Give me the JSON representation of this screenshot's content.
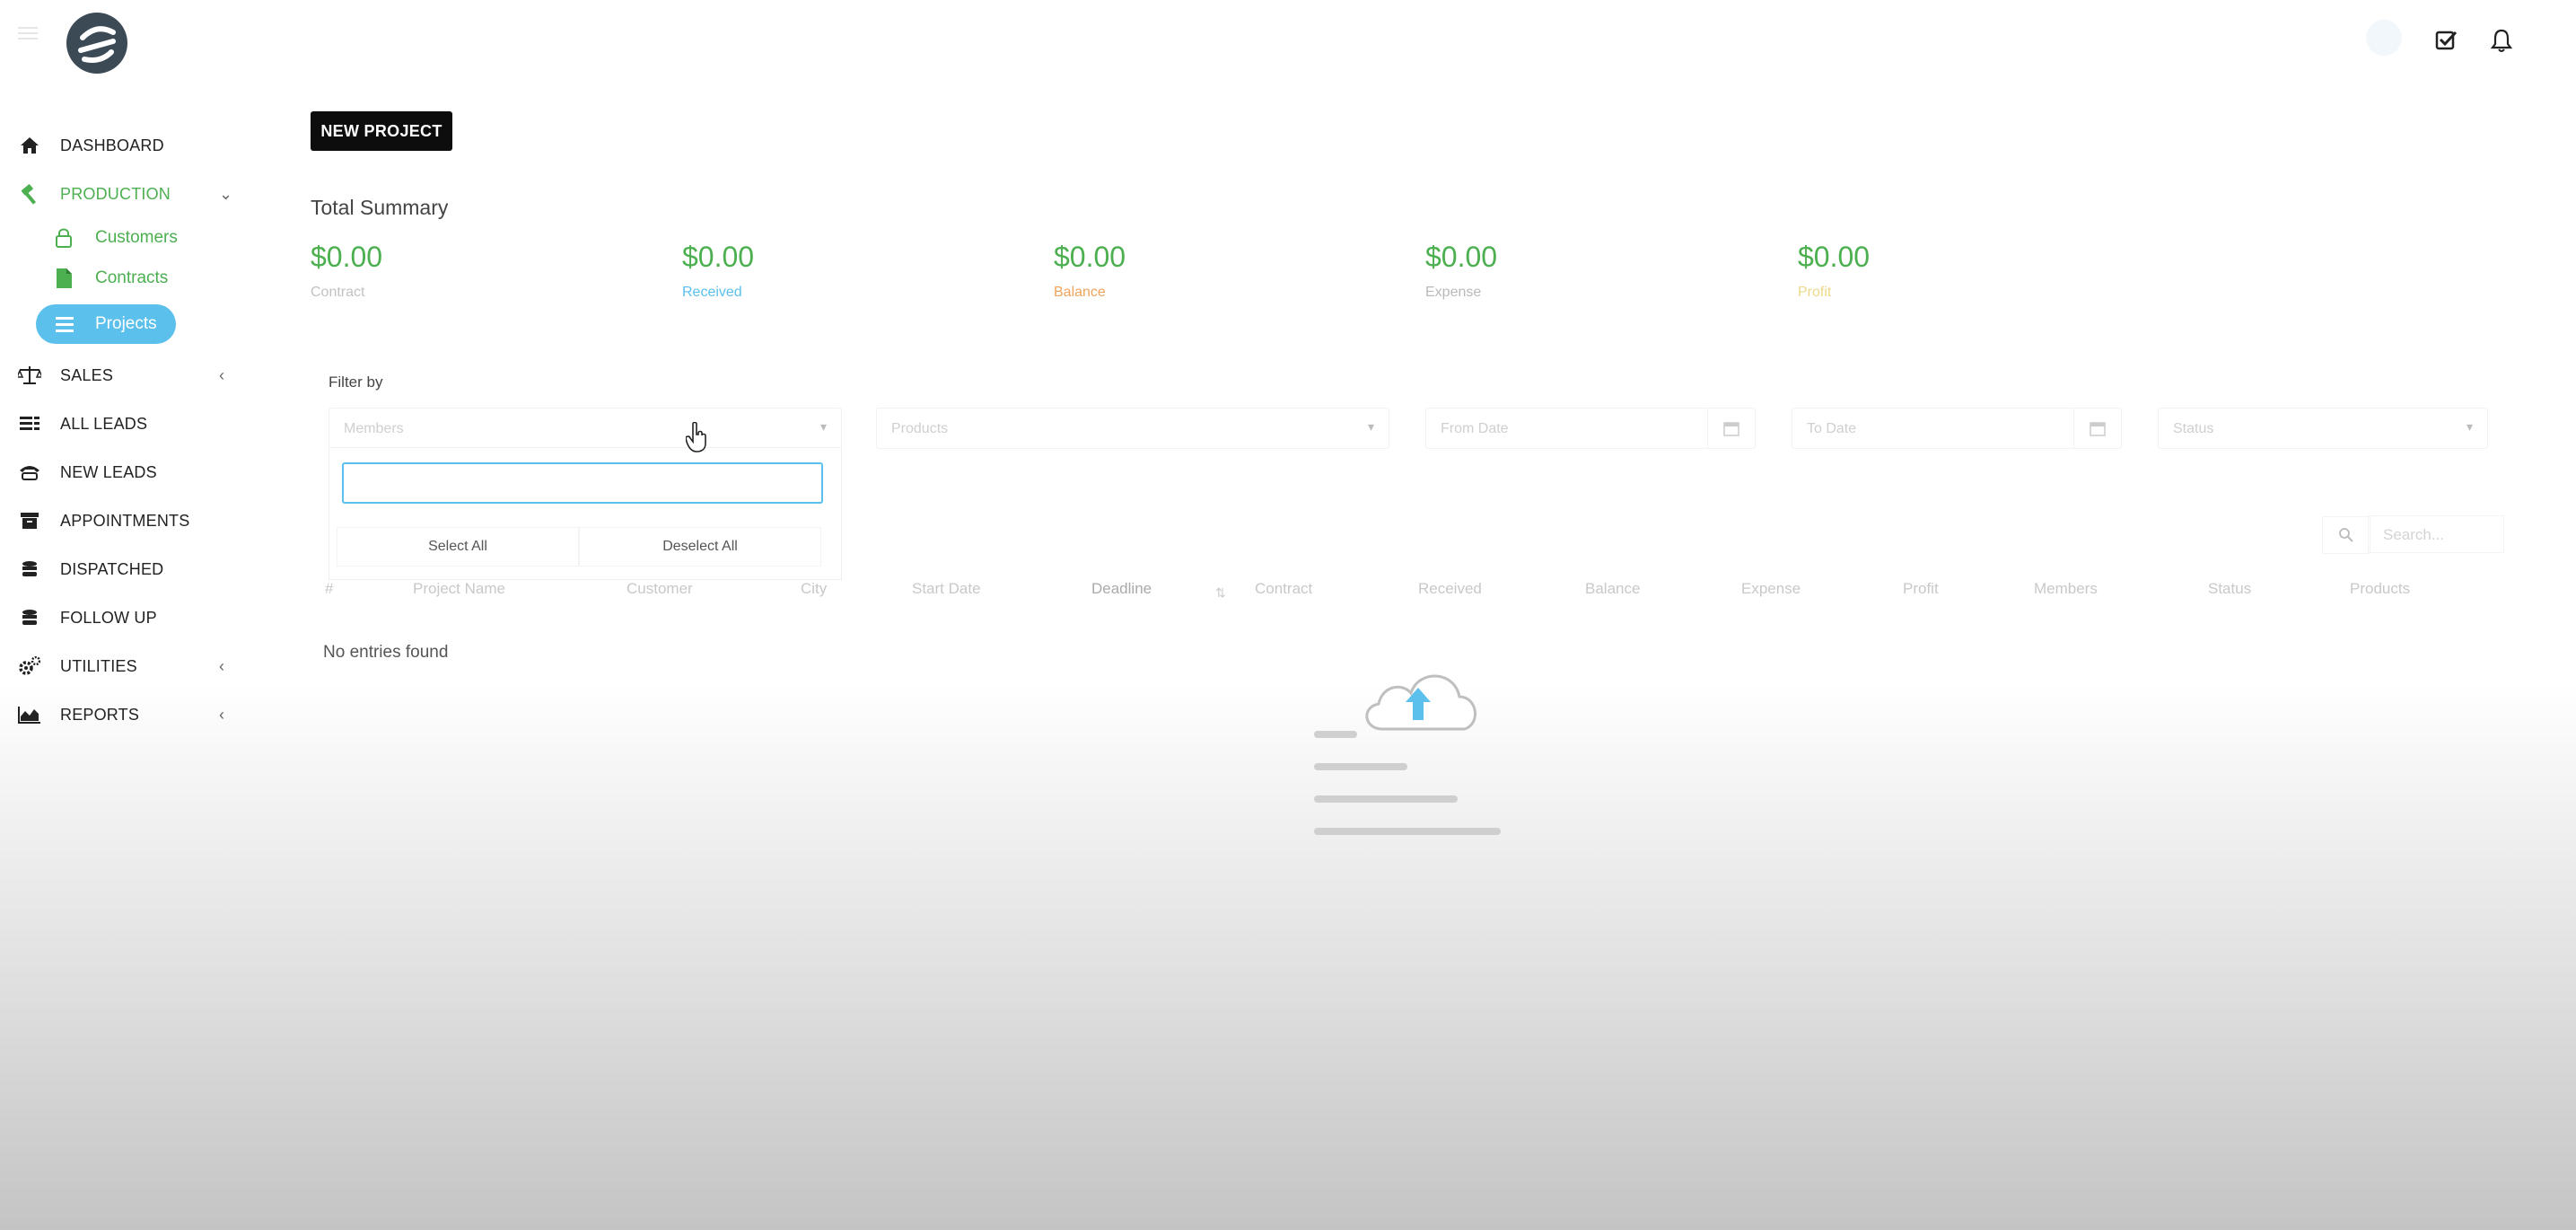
{
  "sidebar": {
    "items": [
      {
        "label": "DASHBOARD",
        "icon": "home-icon"
      },
      {
        "label": "PRODUCTION",
        "icon": "hammer-icon",
        "expanded": true
      },
      {
        "label": "SALES",
        "icon": "scale-icon"
      },
      {
        "label": "ALL LEADS",
        "icon": "list-icon"
      },
      {
        "label": "NEW LEADS",
        "icon": "rotary-phone-icon"
      },
      {
        "label": "APPOINTMENTS",
        "icon": "archive-icon"
      },
      {
        "label": "DISPATCHED",
        "icon": "stack-icon"
      },
      {
        "label": "FOLLOW UP",
        "icon": "stack-icon"
      },
      {
        "label": "UTILITIES",
        "icon": "gears-icon"
      },
      {
        "label": "REPORTS",
        "icon": "area-chart-icon"
      }
    ],
    "production_sub": [
      {
        "label": "Customers",
        "icon": "lock-icon"
      },
      {
        "label": "Contracts",
        "icon": "file-icon"
      },
      {
        "label": "Projects",
        "icon": "menu-lines-icon",
        "active": true
      }
    ]
  },
  "header": {
    "icons": [
      "menu-icon",
      "logo",
      "avatar",
      "check-square-icon",
      "bell-icon"
    ]
  },
  "main": {
    "new_project_label": "NEW PROJECT",
    "summary_title": "Total Summary",
    "summary": [
      {
        "amount": "$0.00",
        "caption": "Contract",
        "color": "#c2c2c2"
      },
      {
        "amount": "$0.00",
        "caption": "Received",
        "color": "#5bc0eb"
      },
      {
        "amount": "$0.00",
        "caption": "Balance",
        "color": "#f0a35c"
      },
      {
        "amount": "$0.00",
        "caption": "Expense",
        "color": "#b9b9b9"
      },
      {
        "amount": "$0.00",
        "caption": "Profit",
        "color": "#ecd98a"
      }
    ],
    "filter_label": "Filter by",
    "filters": {
      "members": "Members",
      "products": "Products",
      "from_date": "From Date",
      "to_date": "To Date",
      "status": "Status"
    },
    "dropdown": {
      "search_value": "",
      "select_all": "Select All",
      "deselect_all": "Deselect All"
    },
    "table": {
      "search_placeholder": "Search...",
      "columns": [
        "#",
        "Project Name",
        "Customer",
        "City",
        "Start Date",
        "Deadline",
        "Contract",
        "Received",
        "Balance",
        "Expense",
        "Profit",
        "Members",
        "Status",
        "Products"
      ],
      "empty_text": "No entries found"
    }
  },
  "colors": {
    "accent_green": "#4caf50",
    "accent_blue": "#5bc0eb",
    "button_dark": "#0d0d0d"
  }
}
